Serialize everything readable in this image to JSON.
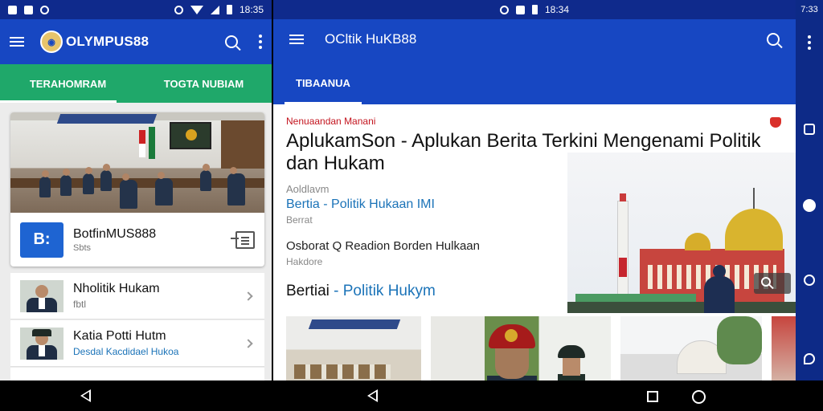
{
  "left": {
    "status_time": "18:35",
    "app_title": "OLYMPUS88",
    "tabs": [
      {
        "label": "TERAHOMRAM"
      },
      {
        "label": "TOGTA NUBIAM"
      }
    ],
    "featured_card": {
      "icon_text": "B:",
      "title": "BotfinMUS888",
      "subtitle": "Sbts"
    },
    "list_items": [
      {
        "title": "Nholitik Hukam",
        "subtitle": "fbtl",
        "subtitle_style": "gray"
      },
      {
        "title": "Katia Potti Hutm",
        "subtitle": "Desdal Kacdidael Hukoa",
        "subtitle_style": "blue"
      }
    ]
  },
  "right": {
    "status_time": "18:34",
    "header_title": "OCltik HuKB88",
    "tab_label": "TIBAANUA",
    "hero": {
      "kicker": "Nenuaandan Manani",
      "headline": "AplukamSon - Aplukan Berita Terkini Mengenami Politik dan Hukam",
      "byline": "Aoldlavm"
    },
    "meta1": {
      "title": "Bertia - Politik Hukaan IMI",
      "subtitle": "Berrat"
    },
    "meta2": {
      "title": "Osborat  Q  Readion Borden Hulkaan",
      "subtitle": "Hakdore"
    },
    "section": {
      "prefix": "Bertiai",
      "highlight": "- Politik Hukym"
    }
  },
  "sidenav": {
    "status_time": "7:33"
  },
  "colors": {
    "app_bar_blue": "#1747c2",
    "status_bar_blue": "#0f2a8c",
    "tab_green": "#1fa86a",
    "kicker_red": "#c3141e",
    "link_blue": "#1b73b8"
  },
  "icons": [
    "menu-icon",
    "search-icon",
    "more-vert-icon",
    "share-icon",
    "chevron-right-icon",
    "bookmark-icon",
    "back-icon",
    "recents-icon",
    "home-icon"
  ]
}
